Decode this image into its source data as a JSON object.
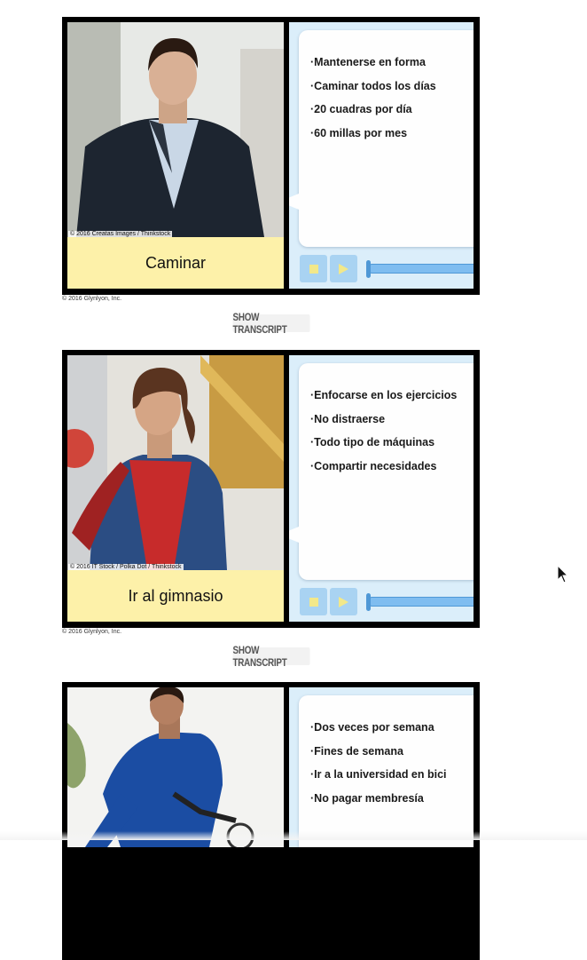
{
  "cards": [
    {
      "credit": "© 2016 Creatas Images / Thinkstock",
      "label": "Caminar",
      "points": [
        "·Mantenerse en forma",
        "·Caminar todos los días",
        "·20 cuadras por día",
        "·60 millas por mes"
      ],
      "copyright": "© 2016 Glynlyon, Inc.",
      "transcript_button": "SHOW TRANSCRIPT",
      "audio_progress": 0
    },
    {
      "credit": "© 2016 IT Stock / Polka Dot / Thinkstock",
      "label": "Ir al gimnasio",
      "points": [
        "·Enfocarse en los ejercicios",
        "·No distraerse",
        "·Todo tipo de máquinas",
        "·Compartir necesidades"
      ],
      "copyright": "© 2016 Glynlyon, Inc.",
      "transcript_button": "SHOW TRANSCRIPT",
      "audio_progress": 0
    },
    {
      "credit": "",
      "label": "",
      "points": [
        "·Dos veces por semana",
        "·Fines de semana",
        "·Ir a la universidad en bici",
        "·No pagar membresía"
      ],
      "copyright": "",
      "transcript_button": "",
      "audio_progress": 0
    }
  ],
  "colors": {
    "label_bg": "#fdf1a9",
    "panel_bg": "#dbeefa",
    "button_bg": "#a9d3f2",
    "icon_yellow": "#f2e88a",
    "track_blue": "#7fbdf0"
  },
  "icons": {
    "stop": "stop-icon",
    "play": "play-icon",
    "cursor": "mouse-pointer-icon"
  }
}
